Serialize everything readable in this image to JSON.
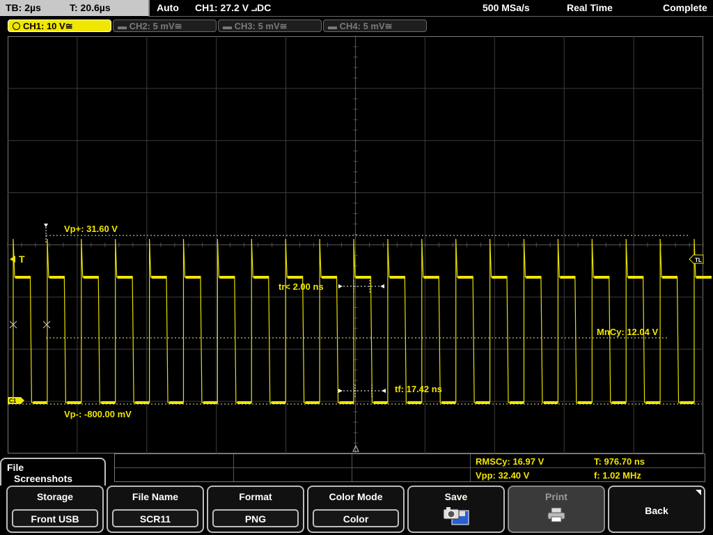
{
  "header": {
    "timebase": "TB: 2µs",
    "trigger_time": "T: 20.6µs",
    "trigger_mode": "Auto",
    "trigger_source": "CH1: 27.2 V ⨼DC",
    "sample_rate": "500 MSa/s",
    "acq_mode": "Real Time",
    "acq_status": "Complete"
  },
  "channels": [
    {
      "label": "CH1: 10 V≅",
      "active": true
    },
    {
      "label": "CH2: 5 mV≅",
      "active": false
    },
    {
      "label": "CH3: 5 mV≅",
      "active": false
    },
    {
      "label": "CH4: 5 mV≅",
      "active": false
    }
  ],
  "markers": {
    "trigger": "T",
    "trigger_level": "TL",
    "ch1": "C1"
  },
  "waveform_measurements": {
    "vp_plus": "Vp+: 31.60 V",
    "vp_minus": "Vp-: -800.00 mV",
    "rise_time": "tr< 2.00 ns",
    "fall_time": "tf: 17.42 ns",
    "mean_cycle": "MnCy: 12.04 V"
  },
  "measurement_panel": {
    "rms_cycle": "RMSCy: 16.97 V",
    "vpp": "Vpp: 32.40 V",
    "period": "T: 976.70 ns",
    "frequency": "f: 1.02 MHz"
  },
  "menu": {
    "title_line1": "File",
    "title_line2": "Screenshots",
    "softkeys": [
      {
        "title": "Storage",
        "value": "Front USB"
      },
      {
        "title": "File Name",
        "value": "SCR11"
      },
      {
        "title": "Format",
        "value": "PNG"
      },
      {
        "title": "Color Mode",
        "value": "Color"
      },
      {
        "title": "Save",
        "icon": "camera-disk-icon"
      },
      {
        "title": "Print",
        "icon": "printer-icon",
        "disabled": true
      },
      {
        "title": "Back"
      }
    ]
  },
  "colors": {
    "trace": "#f0e600",
    "grid": "#3c3c3c",
    "background": "#000000"
  }
}
